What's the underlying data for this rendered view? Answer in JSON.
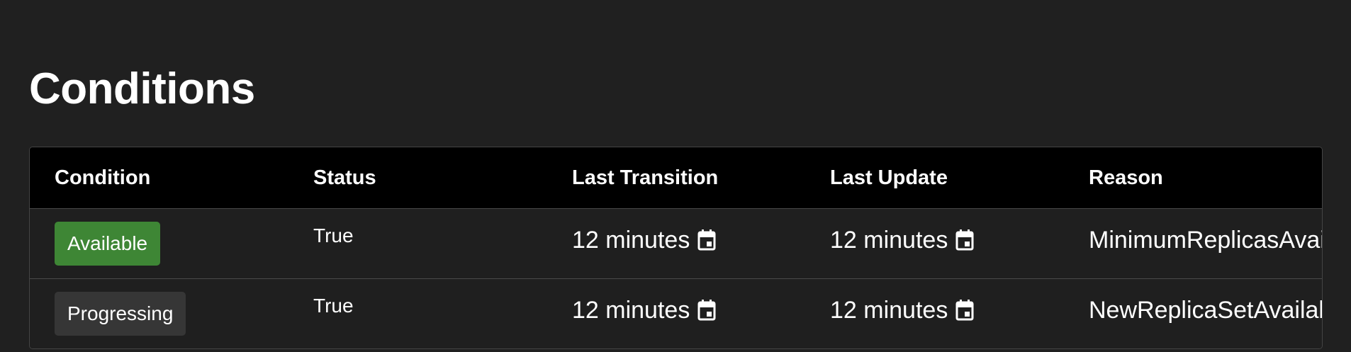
{
  "section": {
    "title": "Conditions"
  },
  "table": {
    "columns": [
      "Condition",
      "Status",
      "Last Transition",
      "Last Update",
      "Reason"
    ],
    "rows": [
      {
        "condition": "Available",
        "condition_style": "success",
        "status": "True",
        "last_transition": "12 minutes",
        "last_update": "12 minutes",
        "reason": "MinimumReplicasAvailable"
      },
      {
        "condition": "Progressing",
        "condition_style": "default",
        "status": "True",
        "last_transition": "12 minutes",
        "last_update": "12 minutes",
        "reason": "NewReplicaSetAvailable"
      }
    ]
  },
  "icons": {
    "timestamp": "calendar-icon"
  },
  "colors": {
    "background": "#202020",
    "header_background": "#000000",
    "success_badge": "#3e8635",
    "default_badge": "#363636",
    "text": "#ffffff"
  }
}
